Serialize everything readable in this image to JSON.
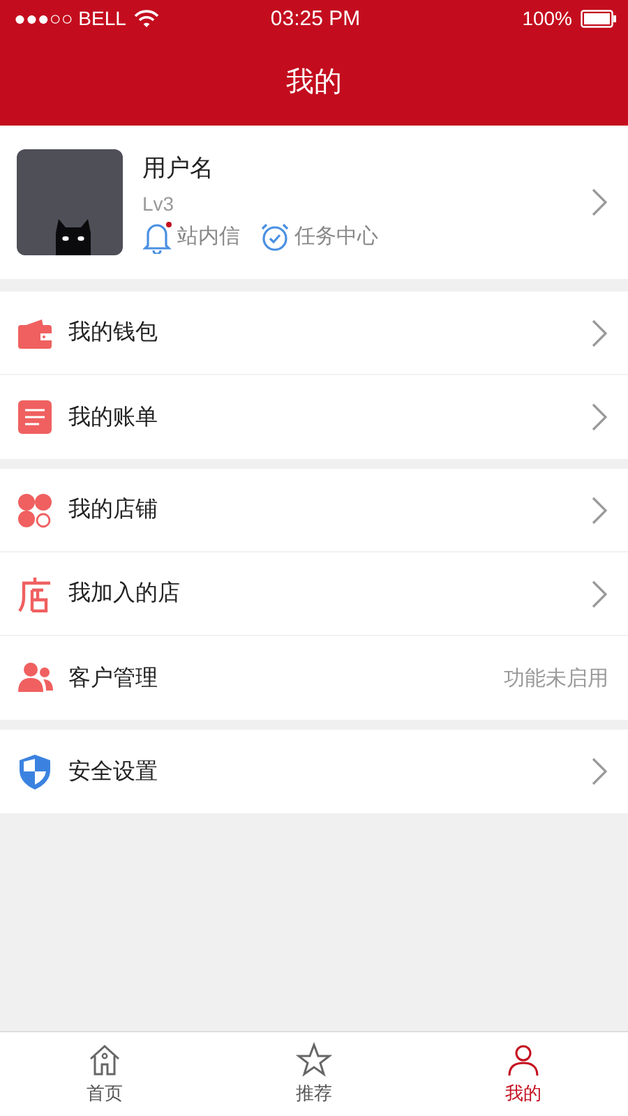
{
  "status_bar": {
    "carrier": "●●●○○ BELL",
    "time": "03:25 PM",
    "battery": "100%"
  },
  "header": {
    "title": "我的"
  },
  "profile": {
    "username": "用户名",
    "level_text": "Lv3",
    "links": [
      {
        "label": "站内信",
        "unread": true
      },
      {
        "label": "任务中心"
      }
    ]
  },
  "sections": [
    [
      {
        "label": "我的钱包",
        "kind": "chevron"
      },
      {
        "label": "我的账单",
        "kind": "chevron"
      }
    ],
    [
      {
        "label": "我的店铺",
        "kind": "chevron"
      },
      {
        "label": "我加入的店",
        "kind": "chevron"
      },
      {
        "label": "客户管理",
        "kind": "note",
        "note": "功能未启用"
      }
    ],
    [
      {
        "label": "安全设置",
        "kind": "chevron"
      }
    ]
  ],
  "tabs": [
    {
      "label": "首页",
      "selected": false
    },
    {
      "label": "推荐",
      "selected": false
    },
    {
      "label": "我的",
      "selected": true
    }
  ]
}
